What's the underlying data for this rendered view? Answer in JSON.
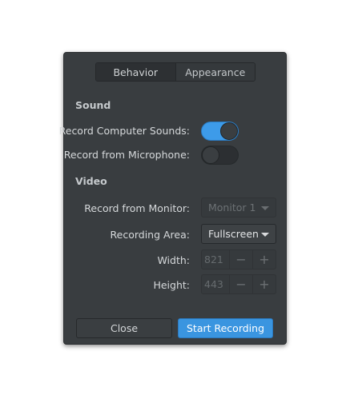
{
  "tabs": [
    {
      "label": "Behavior",
      "active": true
    },
    {
      "label": "Appearance",
      "active": false
    }
  ],
  "sound": {
    "heading": "Sound",
    "computer_sounds_label": "Record Computer Sounds:",
    "computer_sounds_on": true,
    "microphone_label": "Record from Microphone:",
    "microphone_on": false
  },
  "video": {
    "heading": "Video",
    "monitor_label": "Record from Monitor:",
    "monitor_value": "Monitor 1",
    "area_label": "Recording Area:",
    "area_value": "Fullscreen",
    "width_label": "Width:",
    "width_value": "821",
    "height_label": "Height:",
    "height_value": "443",
    "minus_glyph": "−",
    "plus_glyph": "+"
  },
  "buttons": {
    "close": "Close",
    "start": "Start Recording"
  },
  "colors": {
    "accent": "#3a95e0",
    "dialog_bg": "#393d40"
  }
}
